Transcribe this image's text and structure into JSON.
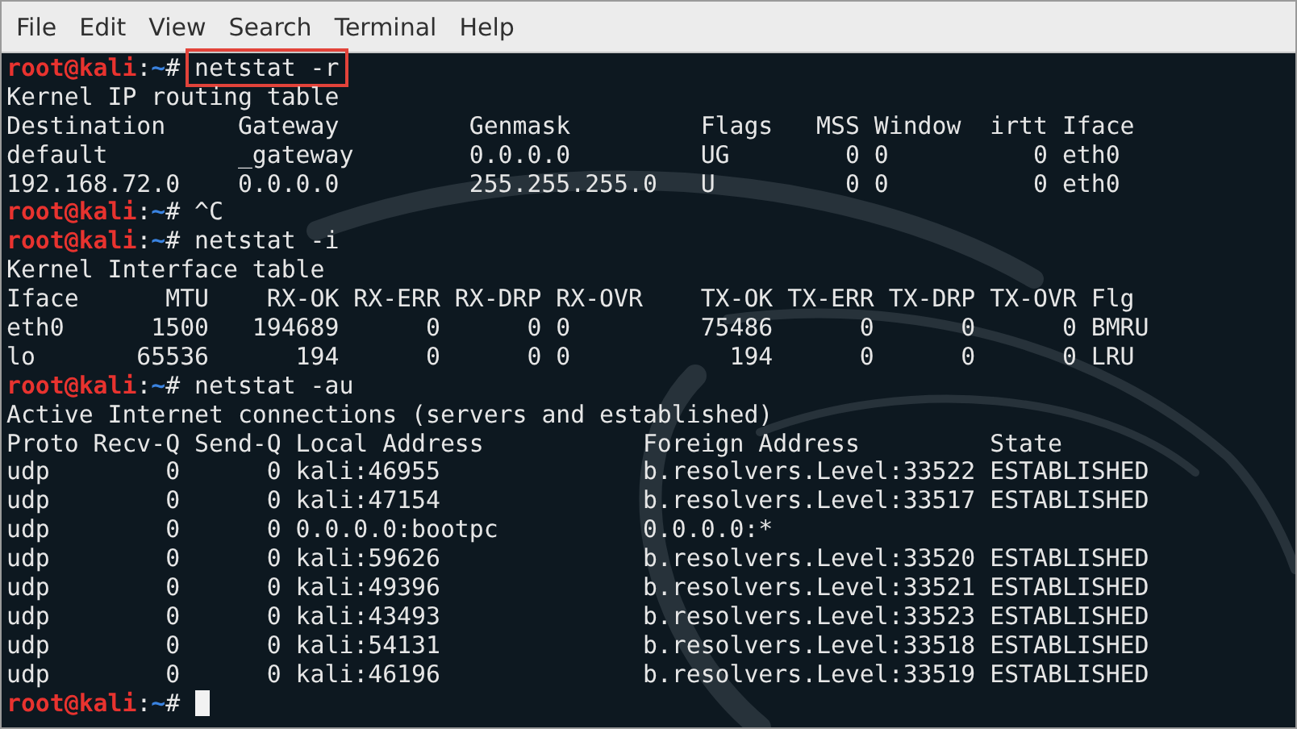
{
  "menu": [
    {
      "label": "File"
    },
    {
      "label": "Edit"
    },
    {
      "label": "View"
    },
    {
      "label": "Search"
    },
    {
      "label": "Terminal"
    },
    {
      "label": "Help"
    }
  ],
  "lines": [
    {
      "kind": "prompt",
      "user": "root@kali",
      "sep": ":",
      "path": "~",
      "symbol": "#",
      "command": "netstat -r",
      "highlighted": true
    },
    {
      "kind": "output",
      "text": "Kernel IP routing table"
    },
    {
      "kind": "output",
      "text": "Destination     Gateway         Genmask         Flags   MSS Window  irtt Iface"
    },
    {
      "kind": "output",
      "text": "default         _gateway        0.0.0.0         UG        0 0          0 eth0"
    },
    {
      "kind": "output",
      "text": "192.168.72.0    0.0.0.0         255.255.255.0   U         0 0          0 eth0"
    },
    {
      "kind": "prompt",
      "user": "root@kali",
      "sep": ":",
      "path": "~",
      "symbol": "#",
      "command": "^C",
      "highlighted": false
    },
    {
      "kind": "prompt",
      "user": "root@kali",
      "sep": ":",
      "path": "~",
      "symbol": "#",
      "command": "netstat -i",
      "highlighted": false
    },
    {
      "kind": "output",
      "text": "Kernel Interface table"
    },
    {
      "kind": "output",
      "text": "Iface      MTU    RX-OK RX-ERR RX-DRP RX-OVR    TX-OK TX-ERR TX-DRP TX-OVR Flg"
    },
    {
      "kind": "output",
      "text": "eth0      1500   194689      0      0 0         75486      0      0      0 BMRU"
    },
    {
      "kind": "output",
      "text": "lo       65536      194      0      0 0           194      0      0      0 LRU"
    },
    {
      "kind": "prompt",
      "user": "root@kali",
      "sep": ":",
      "path": "~",
      "symbol": "#",
      "command": "netstat -au",
      "highlighted": false
    },
    {
      "kind": "output",
      "text": "Active Internet connections (servers and established)"
    },
    {
      "kind": "output",
      "text": "Proto Recv-Q Send-Q Local Address           Foreign Address         State"
    },
    {
      "kind": "output",
      "text": "udp        0      0 kali:46955              b.resolvers.Level:33522 ESTABLISHED"
    },
    {
      "kind": "output",
      "text": "udp        0      0 kali:47154              b.resolvers.Level:33517 ESTABLISHED"
    },
    {
      "kind": "output",
      "text": "udp        0      0 0.0.0.0:bootpc          0.0.0.0:*"
    },
    {
      "kind": "output",
      "text": "udp        0      0 kali:59626              b.resolvers.Level:33520 ESTABLISHED"
    },
    {
      "kind": "output",
      "text": "udp        0      0 kali:49396              b.resolvers.Level:33521 ESTABLISHED"
    },
    {
      "kind": "output",
      "text": "udp        0      0 kali:43493              b.resolvers.Level:33523 ESTABLISHED"
    },
    {
      "kind": "output",
      "text": "udp        0      0 kali:54131              b.resolvers.Level:33518 ESTABLISHED"
    },
    {
      "kind": "output",
      "text": "udp        0      0 kali:46196              b.resolvers.Level:33519 ESTABLISHED"
    },
    {
      "kind": "prompt",
      "user": "root@kali",
      "sep": ":",
      "path": "~",
      "symbol": "#",
      "cursor": true
    }
  ]
}
